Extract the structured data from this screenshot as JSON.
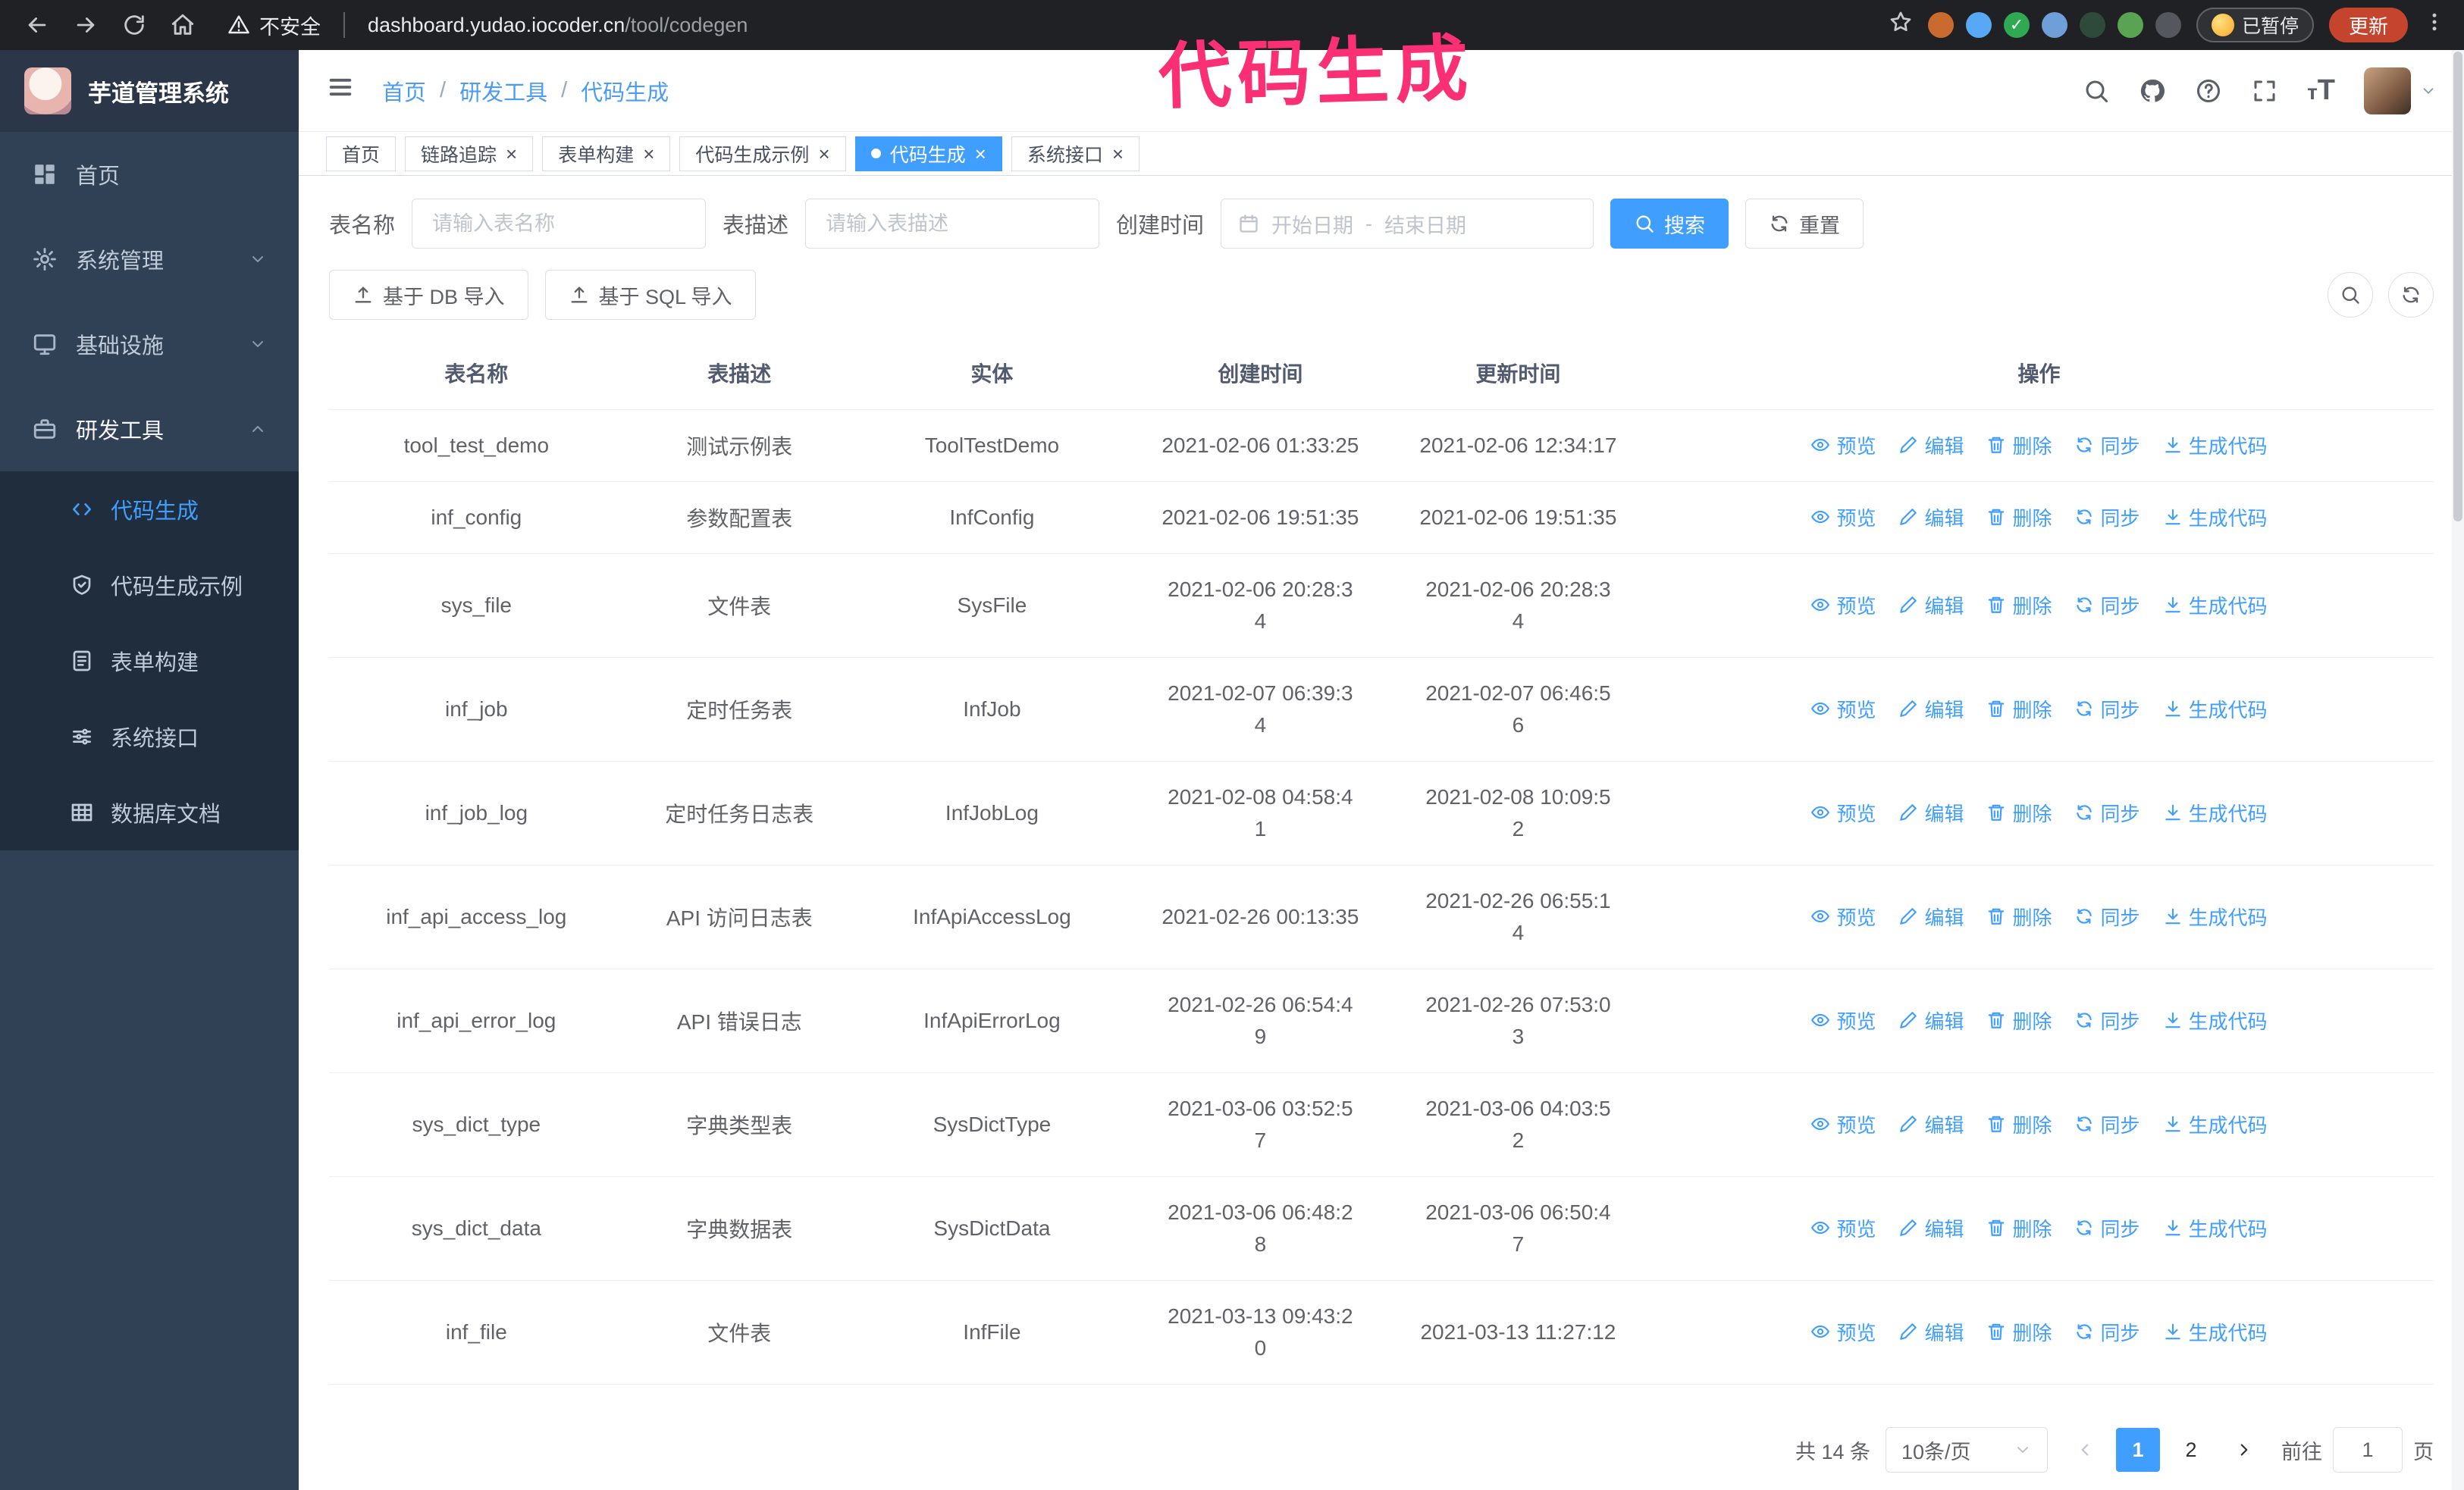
{
  "browser": {
    "security_warning": "不安全",
    "url_host": "dashboard.yudao.iocoder.cn",
    "url_path": "/tool/codegen",
    "extensions": [
      {
        "color": "#c96a2f"
      },
      {
        "color": "#57a8f5"
      },
      {
        "color": "#2faa53",
        "glyph": "✓"
      },
      {
        "color": "#6f9fd8"
      },
      {
        "color": "#2e4a3a"
      },
      {
        "color": "#59a353"
      },
      {
        "color": "#54575e"
      }
    ],
    "paused_badge": "已暂停",
    "update_button": "更新"
  },
  "annotation": "代码生成",
  "sidebar": {
    "app_title": "芋道管理系统",
    "items": [
      {
        "id": "home",
        "label": "首页",
        "icon": "dashboard-icon"
      },
      {
        "id": "system",
        "label": "系统管理",
        "icon": "gear-icon",
        "chevron": "down"
      },
      {
        "id": "infra",
        "label": "基础设施",
        "icon": "monitor-icon",
        "chevron": "down"
      },
      {
        "id": "devtools",
        "label": "研发工具",
        "icon": "briefcase-icon",
        "chevron": "up",
        "expanded": true,
        "children": [
          {
            "id": "codegen",
            "label": "代码生成",
            "icon": "code-icon",
            "active": true
          },
          {
            "id": "codegen-example",
            "label": "代码生成示例",
            "icon": "shield-icon"
          },
          {
            "id": "form-builder",
            "label": "表单构建",
            "icon": "form-icon"
          },
          {
            "id": "api",
            "label": "系统接口",
            "icon": "sliders-icon"
          },
          {
            "id": "db-doc",
            "label": "数据库文档",
            "icon": "table-icon"
          }
        ]
      }
    ]
  },
  "header": {
    "breadcrumb": [
      "首页",
      "研发工具",
      "代码生成"
    ]
  },
  "tabs": [
    {
      "id": "home",
      "label": "首页",
      "closable": false
    },
    {
      "id": "tracing",
      "label": "链路追踪",
      "closable": true
    },
    {
      "id": "form-builder",
      "label": "表单构建",
      "closable": true
    },
    {
      "id": "codegen-example",
      "label": "代码生成示例",
      "closable": true
    },
    {
      "id": "codegen",
      "label": "代码生成",
      "closable": true,
      "active": true
    },
    {
      "id": "api",
      "label": "系统接口",
      "closable": true
    }
  ],
  "filters": {
    "table_name_label": "表名称",
    "table_name_placeholder": "请输入表名称",
    "table_desc_label": "表描述",
    "table_desc_placeholder": "请输入表描述",
    "create_time_label": "创建时间",
    "date_start_placeholder": "开始日期",
    "date_separator": "-",
    "date_end_placeholder": "结束日期",
    "search_button": "搜索",
    "reset_button": "重置"
  },
  "toolbar": {
    "import_db": "基于 DB 导入",
    "import_sql": "基于 SQL 导入"
  },
  "table": {
    "columns": [
      "表名称",
      "表描述",
      "实体",
      "创建时间",
      "更新时间",
      "操作"
    ],
    "actions": [
      {
        "id": "preview",
        "label": "预览",
        "icon": "eye-icon"
      },
      {
        "id": "edit",
        "label": "编辑",
        "icon": "edit-icon"
      },
      {
        "id": "delete",
        "label": "删除",
        "icon": "delete-icon"
      },
      {
        "id": "sync",
        "label": "同步",
        "icon": "sync-icon"
      },
      {
        "id": "generate",
        "label": "生成代码",
        "icon": "download-icon"
      }
    ],
    "rows": [
      {
        "name": "tool_test_demo",
        "desc": "测试示例表",
        "entity": "ToolTestDemo",
        "created": "2021-02-06 01:33:25",
        "updated": "2021-02-06 12:34:17"
      },
      {
        "name": "inf_config",
        "desc": "参数配置表",
        "entity": "InfConfig",
        "created": "2021-02-06 19:51:35",
        "updated": "2021-02-06 19:51:35"
      },
      {
        "name": "sys_file",
        "desc": "文件表",
        "entity": "SysFile",
        "created": "2021-02-06 20:28:3\n4",
        "updated": "2021-02-06 20:28:3\n4"
      },
      {
        "name": "inf_job",
        "desc": "定时任务表",
        "entity": "InfJob",
        "created": "2021-02-07 06:39:3\n4",
        "updated": "2021-02-07 06:46:5\n6"
      },
      {
        "name": "inf_job_log",
        "desc": "定时任务日志表",
        "entity": "InfJobLog",
        "created": "2021-02-08 04:58:4\n1",
        "updated": "2021-02-08 10:09:5\n2"
      },
      {
        "name": "inf_api_access_log",
        "desc": "API 访问日志表",
        "entity": "InfApiAccessLog",
        "created": "2021-02-26 00:13:35",
        "updated": "2021-02-26 06:55:1\n4"
      },
      {
        "name": "inf_api_error_log",
        "desc": "API 错误日志",
        "entity": "InfApiErrorLog",
        "created": "2021-02-26 06:54:4\n9",
        "updated": "2021-02-26 07:53:0\n3"
      },
      {
        "name": "sys_dict_type",
        "desc": "字典类型表",
        "entity": "SysDictType",
        "created": "2021-03-06 03:52:5\n7",
        "updated": "2021-03-06 04:03:5\n2"
      },
      {
        "name": "sys_dict_data",
        "desc": "字典数据表",
        "entity": "SysDictData",
        "created": "2021-03-06 06:48:2\n8",
        "updated": "2021-03-06 06:50:4\n7"
      },
      {
        "name": "inf_file",
        "desc": "文件表",
        "entity": "InfFile",
        "created": "2021-03-13 09:43:2\n0",
        "updated": "2021-03-13 11:27:12"
      }
    ]
  },
  "pagination": {
    "total": "共 14 条",
    "page_size": "10条/页",
    "pages": [
      {
        "label": "1",
        "active": true
      },
      {
        "label": "2",
        "active": false
      }
    ],
    "goto_label": "前往",
    "goto_value": "1",
    "goto_suffix": "页"
  }
}
